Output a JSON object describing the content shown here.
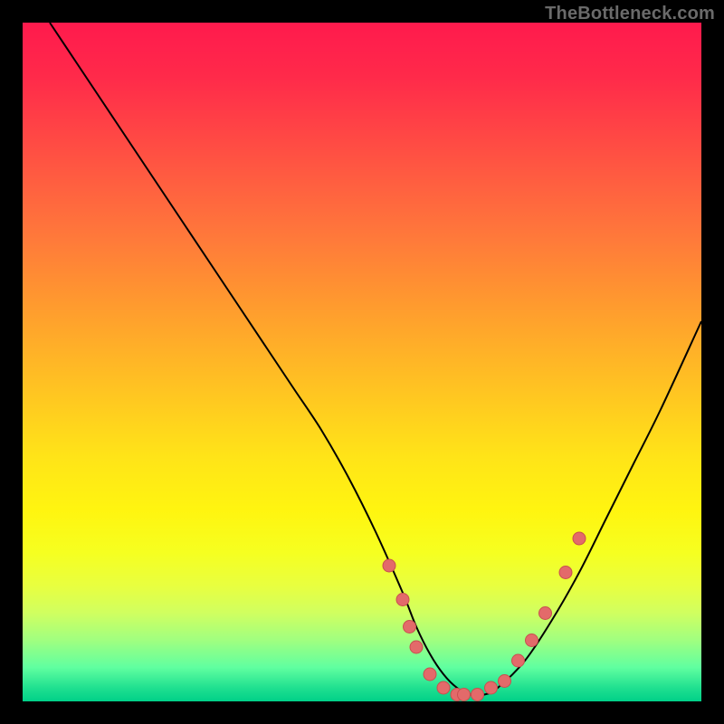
{
  "watermark": "TheBottleneck.com",
  "colors": {
    "background": "#000000",
    "curve_stroke": "#000000",
    "marker_fill": "#e36a6a",
    "marker_stroke": "#c94f4f"
  },
  "chart_data": {
    "type": "line",
    "title": "",
    "xlabel": "",
    "ylabel": "",
    "xlim": [
      0,
      100
    ],
    "ylim": [
      0,
      100
    ],
    "grid": false,
    "series": [
      {
        "name": "bottleneck-curve",
        "x": [
          4,
          8,
          12,
          16,
          20,
          24,
          28,
          32,
          36,
          40,
          44,
          48,
          52,
          56,
          58,
          60,
          62,
          64,
          66,
          68,
          70,
          74,
          78,
          82,
          86,
          90,
          94,
          100
        ],
        "values": [
          100,
          94,
          88,
          82,
          76,
          70,
          64,
          58,
          52,
          46,
          40,
          33,
          25,
          16,
          11,
          7,
          4,
          2,
          1,
          1,
          2,
          6,
          12,
          19,
          27,
          35,
          43,
          56
        ]
      }
    ],
    "markers": [
      {
        "x": 54,
        "y": 20
      },
      {
        "x": 56,
        "y": 15
      },
      {
        "x": 57,
        "y": 11
      },
      {
        "x": 58,
        "y": 8
      },
      {
        "x": 60,
        "y": 4
      },
      {
        "x": 62,
        "y": 2
      },
      {
        "x": 64,
        "y": 1
      },
      {
        "x": 65,
        "y": 1
      },
      {
        "x": 67,
        "y": 1
      },
      {
        "x": 69,
        "y": 2
      },
      {
        "x": 71,
        "y": 3
      },
      {
        "x": 73,
        "y": 6
      },
      {
        "x": 75,
        "y": 9
      },
      {
        "x": 77,
        "y": 13
      },
      {
        "x": 80,
        "y": 19
      },
      {
        "x": 82,
        "y": 24
      }
    ]
  }
}
